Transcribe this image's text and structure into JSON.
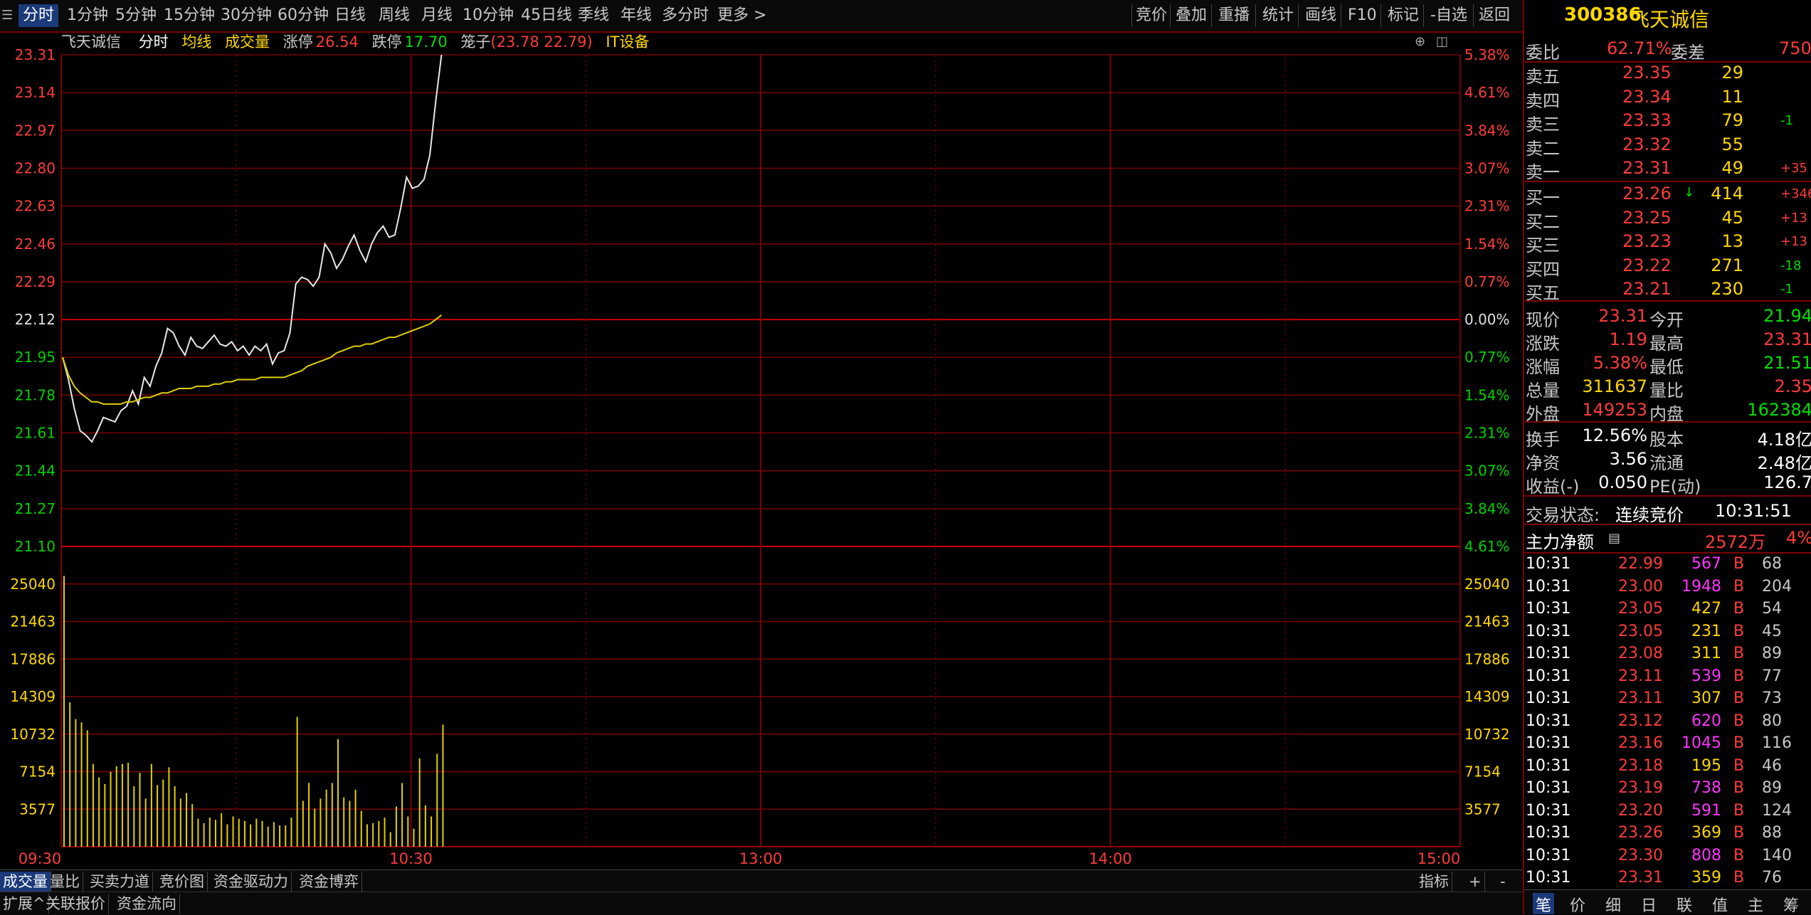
{
  "toolbar": {
    "periods": [
      "分时",
      "1分钟",
      "5分钟",
      "15分钟",
      "30分钟",
      "60分钟",
      "日线",
      "周线",
      "月线",
      "10分钟",
      "45日线",
      "季线",
      "年线",
      "多分时",
      "更多 >"
    ],
    "active_period": "分时",
    "tools": [
      "竞价",
      "叠加",
      "重播",
      "统计",
      "画线",
      "F10",
      "标记",
      "-自选",
      "返回"
    ]
  },
  "info": {
    "name": "飞天诚信",
    "mode": "分时",
    "avg_label": "均线",
    "vol_label": "成交量",
    "limit_up_label": "涨停",
    "limit_up": "26.54",
    "limit_down_label": "跌停",
    "limit_down": "17.70",
    "lag_label": "笼子",
    "lag_value": "(23.78 22.79)",
    "sector": "IT设备"
  },
  "chart_data": {
    "type": "line",
    "prev_close": 22.12,
    "y_ticks_price": [
      "23.31",
      "23.14",
      "22.97",
      "22.80",
      "22.63",
      "22.46",
      "22.29",
      "22.12",
      "21.95",
      "21.78",
      "21.61",
      "21.44",
      "21.27",
      "21.10"
    ],
    "y_ticks_pct": [
      "5.38%",
      "4.61%",
      "3.84%",
      "3.07%",
      "2.31%",
      "1.54%",
      "0.77%",
      "0.00%",
      "0.77%",
      "1.54%",
      "2.31%",
      "3.07%",
      "3.84%",
      "4.61%"
    ],
    "vol_ticks": [
      "25040",
      "21463",
      "17886",
      "14309",
      "10732",
      "7154",
      "3577"
    ],
    "x_ticks": [
      "09:30",
      "10:30",
      "13:00",
      "14:00",
      "15:00"
    ],
    "ylim": [
      21.02,
      23.31
    ],
    "vol_max": 26827,
    "minutes": 240,
    "series": [
      {
        "name": "价格",
        "values": [
          21.95,
          21.85,
          21.72,
          21.62,
          21.6,
          21.57,
          21.62,
          21.68,
          21.67,
          21.66,
          21.71,
          21.73,
          21.8,
          21.74,
          21.86,
          21.82,
          21.91,
          21.97,
          22.08,
          22.06,
          22.0,
          21.96,
          22.04,
          22.0,
          21.99,
          22.02,
          22.05,
          22.01,
          22.0,
          22.02,
          21.98,
          22.0,
          21.96,
          22.0,
          21.98,
          22.01,
          21.92,
          21.97,
          21.98,
          22.06,
          22.28,
          22.31,
          22.3,
          22.27,
          22.31,
          22.46,
          22.42,
          22.35,
          22.39,
          22.45,
          22.5,
          22.43,
          22.38,
          22.46,
          22.51,
          22.54,
          22.49,
          22.5,
          22.62,
          22.76,
          22.71,
          22.72,
          22.75,
          22.86,
          23.1,
          23.31
        ]
      },
      {
        "name": "均线",
        "values": [
          21.95,
          21.87,
          21.82,
          21.79,
          21.77,
          21.75,
          21.75,
          21.74,
          21.74,
          21.74,
          21.74,
          21.75,
          21.75,
          21.76,
          21.77,
          21.77,
          21.78,
          21.79,
          21.79,
          21.8,
          21.81,
          21.81,
          21.81,
          21.82,
          21.82,
          21.82,
          21.83,
          21.83,
          21.84,
          21.84,
          21.85,
          21.85,
          21.85,
          21.85,
          21.86,
          21.86,
          21.86,
          21.86,
          21.86,
          21.87,
          21.88,
          21.89,
          21.91,
          21.92,
          21.93,
          21.94,
          21.95,
          21.97,
          21.98,
          21.99,
          22.0,
          22.0,
          22.01,
          22.01,
          22.02,
          22.03,
          22.04,
          22.04,
          22.05,
          22.06,
          22.07,
          22.08,
          22.09,
          22.1,
          22.12,
          22.14
        ]
      }
    ],
    "volume": [
      24200,
      12900,
      11400,
      11100,
      10400,
      7400,
      6200,
      5600,
      6700,
      7200,
      7400,
      7500,
      5400,
      6600,
      4300,
      7400,
      5500,
      6000,
      7100,
      5400,
      4300,
      4800,
      3800,
      2500,
      2100,
      2600,
      2400,
      3000,
      2000,
      2700,
      2500,
      2300,
      2000,
      2500,
      2300,
      1800,
      2200,
      1900,
      1900,
      2600,
      11600,
      4100,
      5700,
      3400,
      4300,
      5100,
      5700,
      9600,
      4400,
      4100,
      5100,
      3200,
      2000,
      2100,
      2300,
      2600,
      1300,
      3600,
      5700,
      2700,
      1600,
      7900,
      3700,
      2700,
      8300,
      10900
    ]
  },
  "bottom": {
    "tabs1": [
      "成交量",
      "量比",
      "买卖力道",
      "竞价图",
      "资金驱动力",
      "资金博弈"
    ],
    "active_tab1": "成交量",
    "right1": [
      "指标",
      "+",
      "-"
    ],
    "tabs2": [
      "扩展^",
      "关联报价",
      "资金流向"
    ]
  },
  "panel": {
    "code": "300386",
    "name": "飞天诚信",
    "weibi_label": "委比",
    "weibi": "62.71%",
    "weicha_label": "委差",
    "weicha": "750",
    "asks": [
      {
        "label": "卖五",
        "price": "23.35",
        "vol": "29",
        "chg": ""
      },
      {
        "label": "卖四",
        "price": "23.34",
        "vol": "11",
        "chg": ""
      },
      {
        "label": "卖三",
        "price": "23.33",
        "vol": "79",
        "chg": "-1"
      },
      {
        "label": "卖二",
        "price": "23.32",
        "vol": "55",
        "chg": ""
      },
      {
        "label": "卖一",
        "price": "23.31",
        "vol": "49",
        "chg": "+35"
      }
    ],
    "bids": [
      {
        "label": "买一",
        "price": "23.26",
        "vol": "414",
        "chg": "+346"
      },
      {
        "label": "买二",
        "price": "23.25",
        "vol": "45",
        "chg": "+13"
      },
      {
        "label": "买三",
        "price": "23.23",
        "vol": "13",
        "chg": "+13"
      },
      {
        "label": "买四",
        "price": "23.22",
        "vol": "271",
        "chg": "-18"
      },
      {
        "label": "买五",
        "price": "23.21",
        "vol": "230",
        "chg": "-1"
      }
    ],
    "stats": [
      {
        "l1": "现价",
        "v1": "23.31",
        "c1": "red",
        "l2": "今开",
        "v2": "21.94",
        "c2": "green"
      },
      {
        "l1": "涨跌",
        "v1": "1.19",
        "c1": "red",
        "l2": "最高",
        "v2": "23.31",
        "c2": "red"
      },
      {
        "l1": "涨幅",
        "v1": "5.38%",
        "c1": "red",
        "l2": "最低",
        "v2": "21.51",
        "c2": "green"
      },
      {
        "l1": "总量",
        "v1": "311637",
        "c1": "yellow",
        "l2": "量比",
        "v2": "2.35",
        "c2": "red"
      },
      {
        "l1": "外盘",
        "v1": "149253",
        "c1": "red",
        "l2": "内盘",
        "v2": "162384",
        "c2": "green"
      }
    ],
    "stats2": [
      {
        "l1": "换手",
        "v1": "12.56%",
        "l2": "股本",
        "v2": "4.18亿"
      },
      {
        "l1": "净资",
        "v1": "3.56",
        "l2": "流通",
        "v2": "2.48亿"
      },
      {
        "l1": "收益(-)",
        "v1": "0.050",
        "l2": "PE(动)",
        "v2": "126.7"
      }
    ],
    "status_label": "交易状态:",
    "status": "连续竞价",
    "status_time": "10:31:51",
    "mainflow_label": "主力净额",
    "mainflow": "2572万",
    "mainflow_pct": "4%",
    "ticks": [
      {
        "t": "10:31",
        "p": "22.99",
        "v": "567",
        "vc": "magenta",
        "d": "B",
        "n": "68"
      },
      {
        "t": "10:31",
        "p": "23.00",
        "v": "1948",
        "vc": "magenta",
        "d": "B",
        "n": "204"
      },
      {
        "t": "10:31",
        "p": "23.05",
        "v": "427",
        "vc": "yellow",
        "d": "B",
        "n": "54"
      },
      {
        "t": "10:31",
        "p": "23.05",
        "v": "231",
        "vc": "yellow",
        "d": "B",
        "n": "45"
      },
      {
        "t": "10:31",
        "p": "23.08",
        "v": "311",
        "vc": "yellow",
        "d": "B",
        "n": "89"
      },
      {
        "t": "10:31",
        "p": "23.11",
        "v": "539",
        "vc": "magenta",
        "d": "B",
        "n": "77"
      },
      {
        "t": "10:31",
        "p": "23.11",
        "v": "307",
        "vc": "yellow",
        "d": "B",
        "n": "73"
      },
      {
        "t": "10:31",
        "p": "23.12",
        "v": "620",
        "vc": "magenta",
        "d": "B",
        "n": "80"
      },
      {
        "t": "10:31",
        "p": "23.16",
        "v": "1045",
        "vc": "magenta",
        "d": "B",
        "n": "116"
      },
      {
        "t": "10:31",
        "p": "23.18",
        "v": "195",
        "vc": "yellow",
        "d": "B",
        "n": "46"
      },
      {
        "t": "10:31",
        "p": "23.19",
        "v": "738",
        "vc": "magenta",
        "d": "B",
        "n": "89"
      },
      {
        "t": "10:31",
        "p": "23.20",
        "v": "591",
        "vc": "magenta",
        "d": "B",
        "n": "124"
      },
      {
        "t": "10:31",
        "p": "23.26",
        "v": "369",
        "vc": "yellow",
        "d": "B",
        "n": "88"
      },
      {
        "t": "10:31",
        "p": "23.30",
        "v": "808",
        "vc": "magenta",
        "d": "B",
        "n": "140"
      },
      {
        "t": "10:31",
        "p": "23.31",
        "v": "359",
        "vc": "yellow",
        "d": "B",
        "n": "76"
      }
    ],
    "tabs": [
      "笔",
      "价",
      "细",
      "日",
      "联",
      "值",
      "主",
      "筹"
    ],
    "active_tab": "笔"
  }
}
